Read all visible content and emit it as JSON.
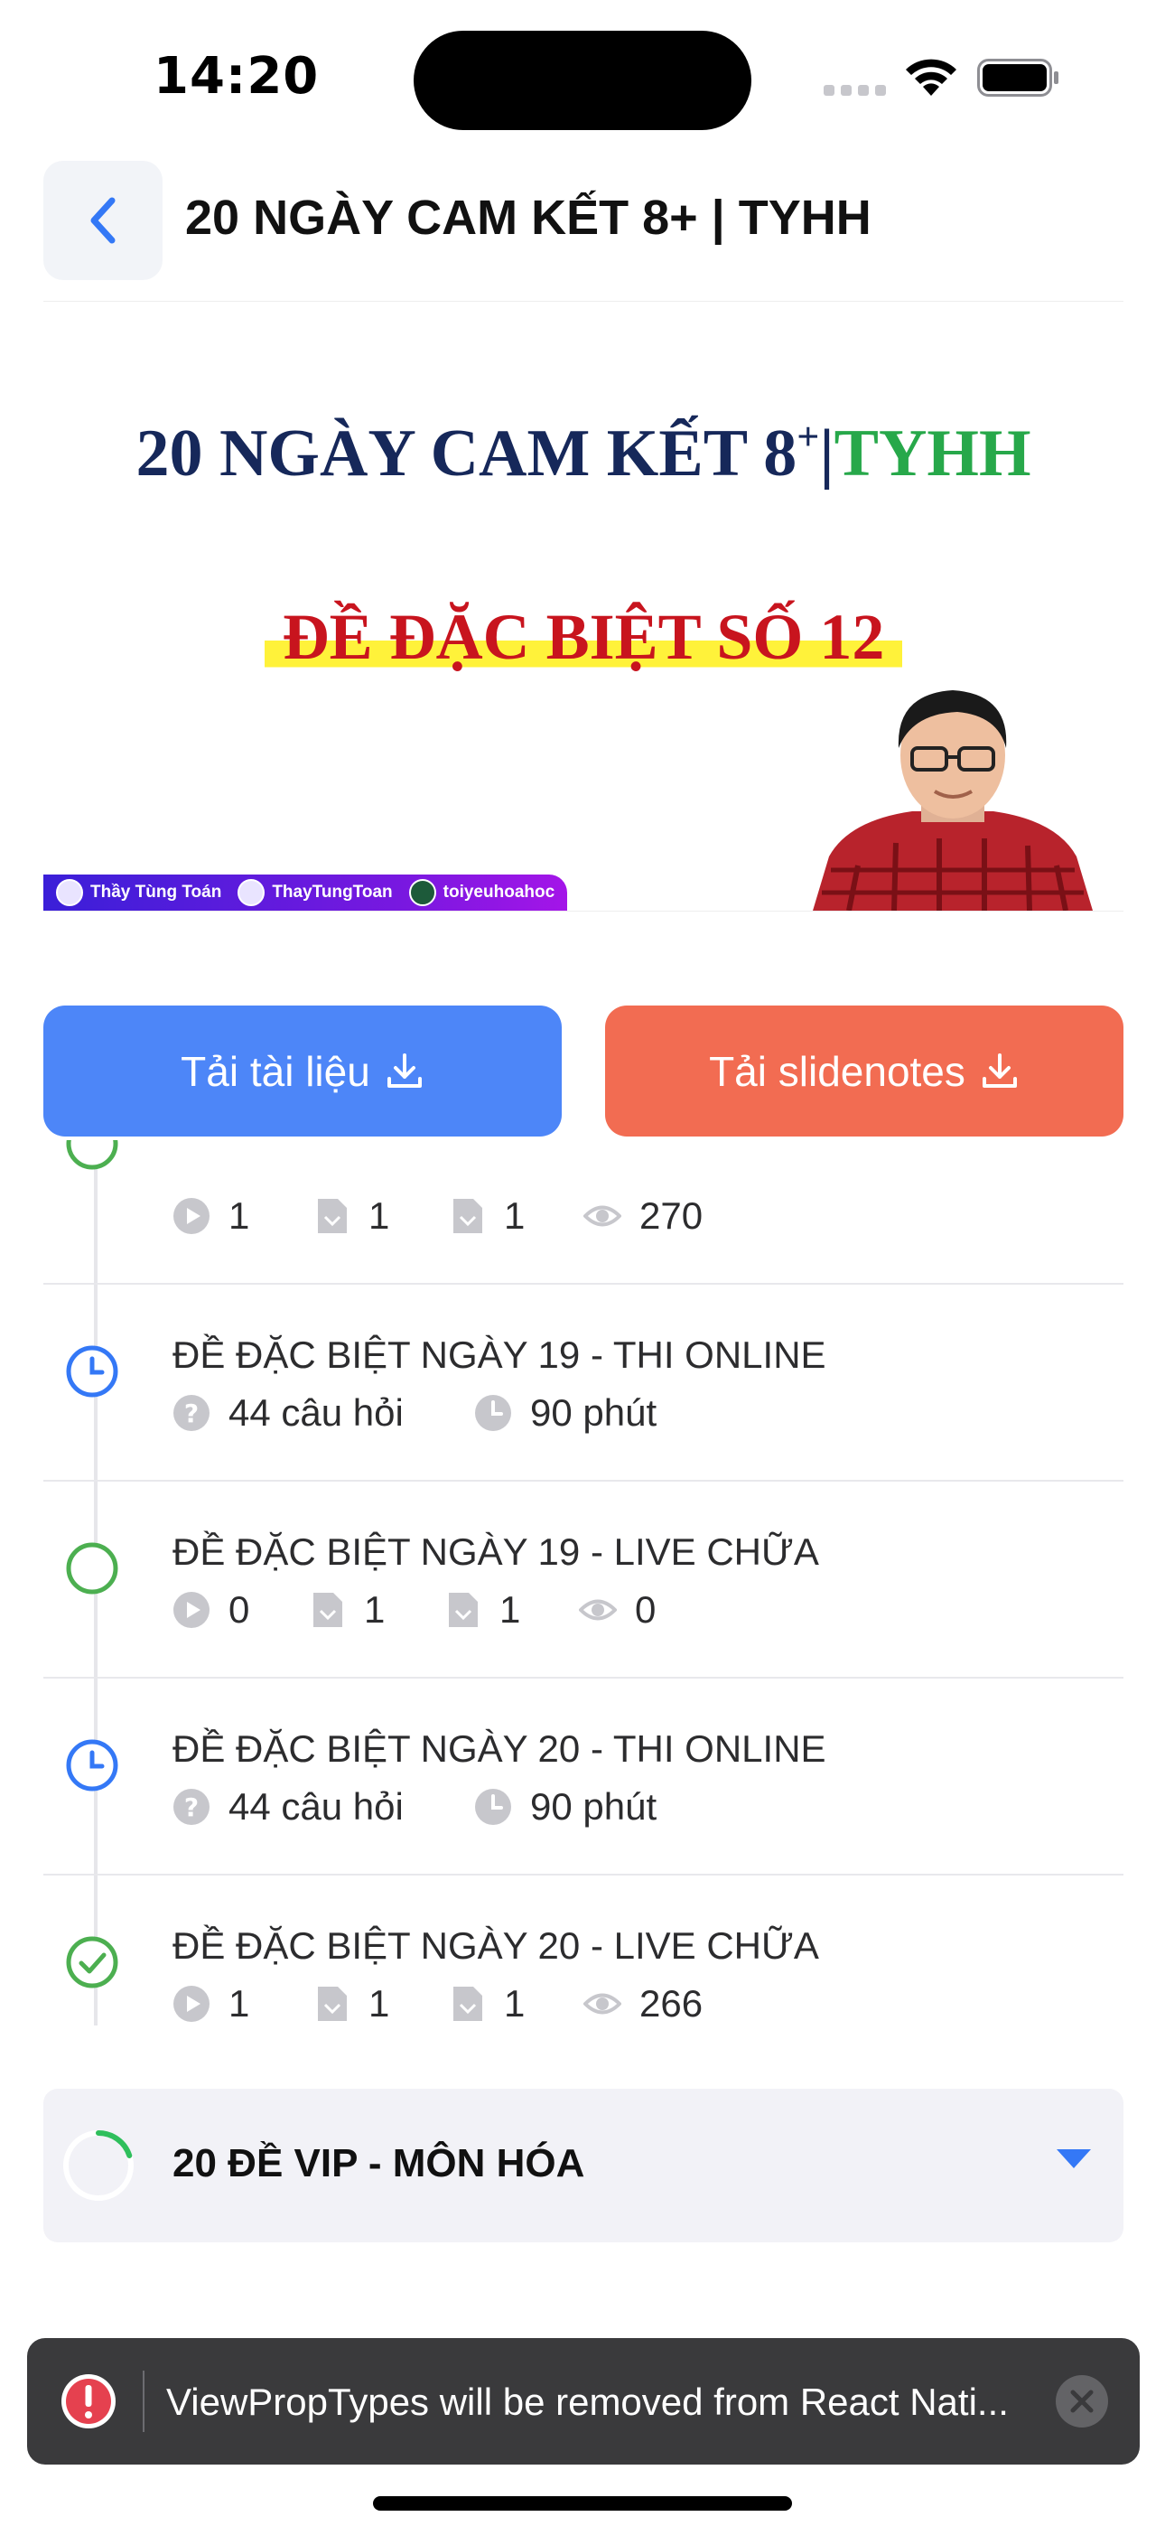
{
  "status_bar": {
    "time": "14:20"
  },
  "header": {
    "title": "20 NGÀY CAM KẾT 8+ | TYHH"
  },
  "banner": {
    "title_main": "20 NGÀY CAM KẾT 8",
    "title_sup": "+",
    "title_sep": "|",
    "title_accent": "TYHH",
    "subtitle": "ĐỀ ĐẶC BIỆT SỐ 12",
    "socials": [
      "Thầy Tùng Toán",
      "ThayTungToan",
      "toiyeuhoahoc"
    ]
  },
  "actions": {
    "download_docs": "Tải tài liệu",
    "download_slides": "Tải slidenotes"
  },
  "lessons": [
    {
      "title": "",
      "status": "partial",
      "type": "live",
      "videos": "1",
      "docs": "1",
      "files": "1",
      "views": "270"
    },
    {
      "title": "ĐỀ ĐẶC BIỆT NGÀY 19 - THI ONLINE",
      "status": "clock",
      "type": "exam",
      "questions": "44 câu hỏi",
      "duration": "90 phút"
    },
    {
      "title": "ĐỀ ĐẶC BIỆT NGÀY 19 - LIVE CHỮA",
      "status": "open",
      "type": "live",
      "videos": "0",
      "docs": "1",
      "files": "1",
      "views": "0"
    },
    {
      "title": "ĐỀ ĐẶC BIỆT NGÀY 20 - THI ONLINE",
      "status": "clock",
      "type": "exam",
      "questions": "44 câu hỏi",
      "duration": "90 phút"
    },
    {
      "title": "ĐỀ ĐẶC BIỆT NGÀY 20 - LIVE CHỮA",
      "status": "done",
      "type": "live",
      "videos": "1",
      "docs": "1",
      "files": "1",
      "views": "266"
    }
  ],
  "section": {
    "title": "20 ĐỀ VIP - MÔN HÓA",
    "progress": 0.2
  },
  "toast": {
    "message": "ViewPropTypes will be removed from React Nati..."
  },
  "colors": {
    "primary": "#4d86f8",
    "secondary": "#f26c52",
    "success": "#4caf50",
    "clock": "#3478f6",
    "error": "#e5414f"
  }
}
